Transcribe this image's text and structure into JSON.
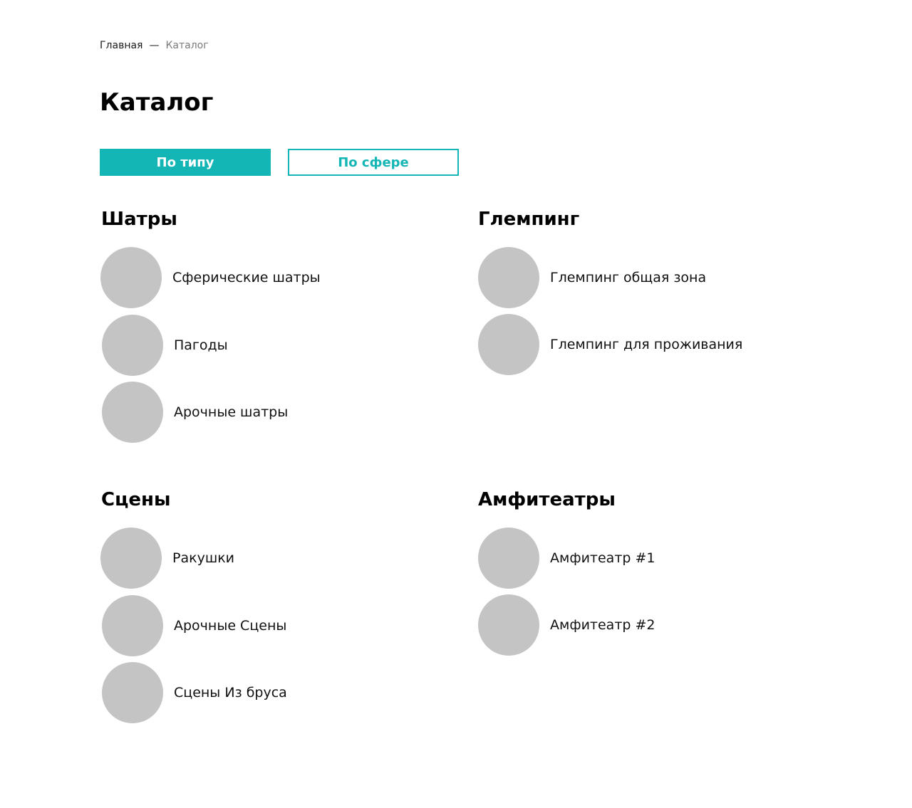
{
  "breadcrumb": {
    "home": "Главная",
    "separator": "—",
    "current": "Каталог"
  },
  "page_title": "Каталог",
  "tabs": [
    {
      "label": "По типу",
      "active": true
    },
    {
      "label": "По сфере",
      "active": false
    }
  ],
  "colors": {
    "accent": "#14b5b5",
    "thumbnail_placeholder": "#c4c4c4"
  },
  "sections": [
    {
      "title": "Шатры",
      "items": [
        {
          "label": "Сферические шатры"
        },
        {
          "label": "Пагоды"
        },
        {
          "label": "Арочные шатры"
        }
      ]
    },
    {
      "title": "Глемпинг",
      "items": [
        {
          "label": "Глемпинг общая зона"
        },
        {
          "label": "Глемпинг для проживания"
        }
      ]
    },
    {
      "title": "Сцены",
      "items": [
        {
          "label": "Ракушки"
        },
        {
          "label": "Арочные Сцены"
        },
        {
          "label": "Сцены Из бруса"
        }
      ]
    },
    {
      "title": "Амфитеатры",
      "items": [
        {
          "label": "Амфитеатр #1"
        },
        {
          "label": "Амфитеатр #2"
        }
      ]
    }
  ]
}
